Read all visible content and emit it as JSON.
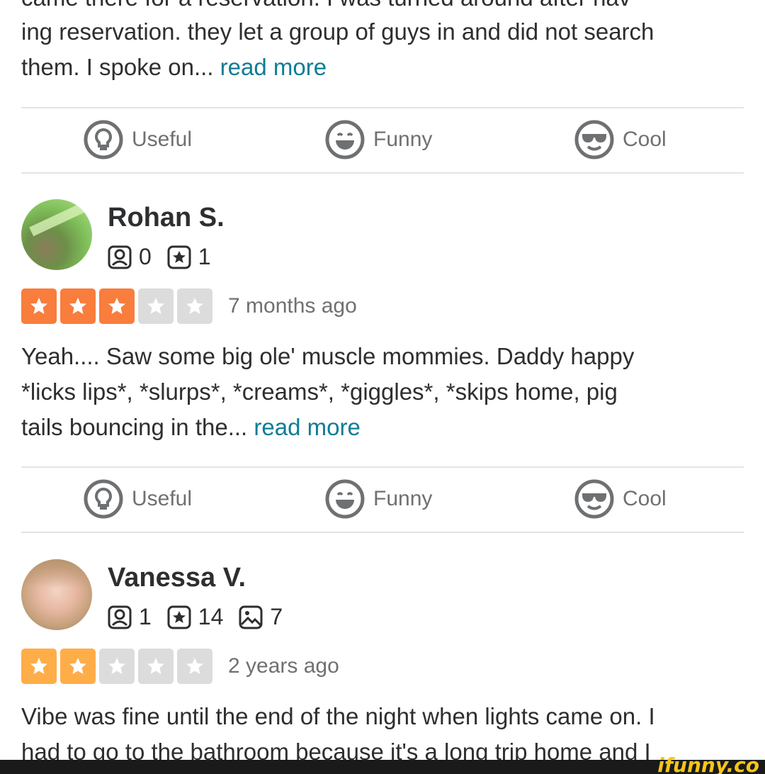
{
  "previous_review": {
    "text_line0": "came there for a reservation. I was turned around after hav",
    "text_line1": "ing reservation. they let a group of guys in and did not search",
    "text_line2": "them. I spoke on...",
    "read_more": "read more",
    "actions": {
      "useful": "Useful",
      "funny": "Funny",
      "cool": "Cool"
    }
  },
  "reviews": [
    {
      "name": "Rohan S.",
      "friends": "0",
      "reviews_count": "1",
      "rating": 3,
      "star_color": "#f97d3c",
      "date": "7 months ago",
      "text_line1": "Yeah.... Saw some big ole' muscle mommies. Daddy happy",
      "text_line2": "*licks lips*, *slurps*, *creams*, *giggles*, *skips home, pig",
      "text_line3": "tails bouncing in the...",
      "read_more": "read more",
      "actions": {
        "useful": "Useful",
        "funny": "Funny",
        "cool": "Cool"
      }
    },
    {
      "name": "Vanessa V.",
      "friends": "1",
      "reviews_count": "14",
      "photos": "7",
      "rating": 2,
      "star_color": "#ffad48",
      "date": "2 years ago",
      "text_line1": "Vibe was fine until the end of the night when lights came on. I",
      "text_line2": "had to go to the bathroom because it's a long trip home and I"
    }
  ],
  "colors": {
    "empty_star": "#dcdcdc",
    "link": "#0e7c96",
    "divider": "#e4e4e4"
  },
  "watermark": "ifunny.co"
}
